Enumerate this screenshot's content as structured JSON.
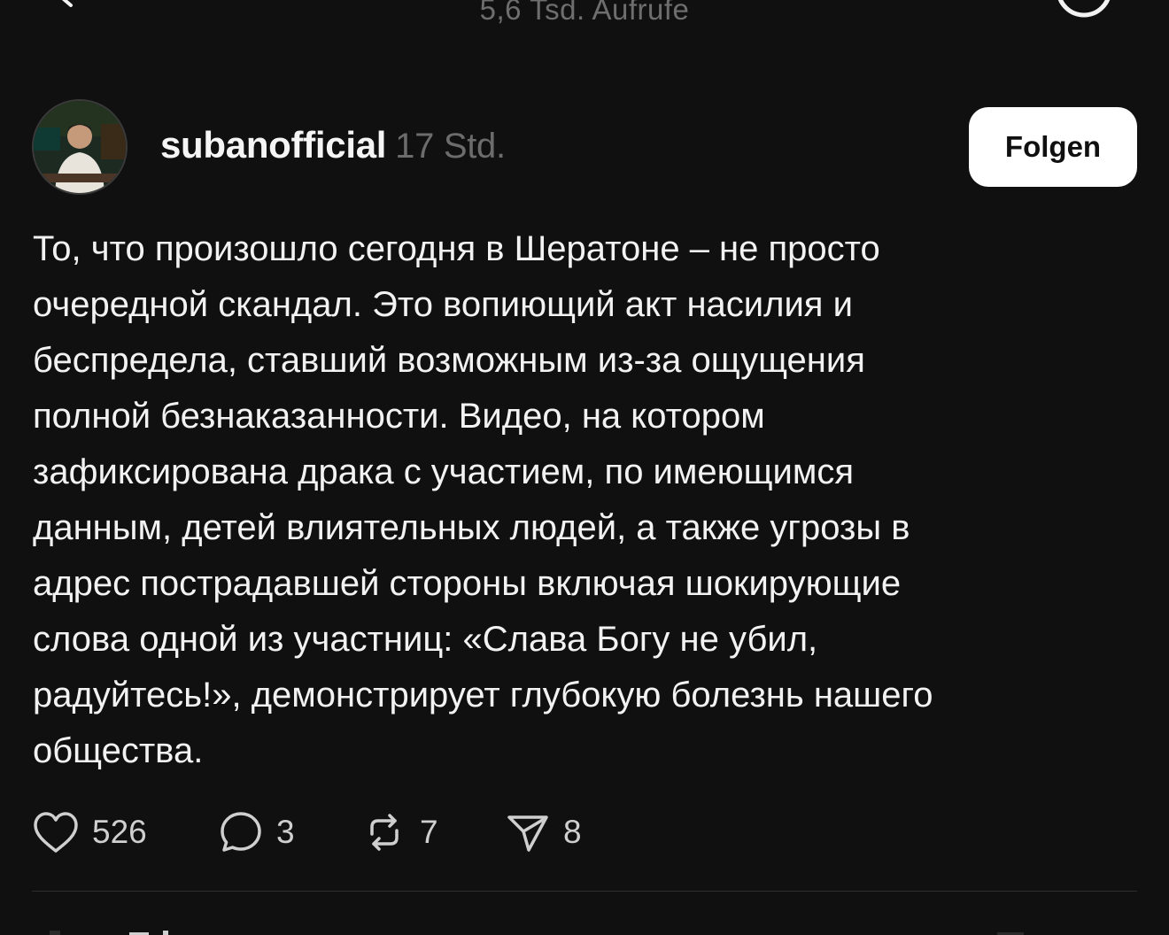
{
  "header": {
    "views_text": "5,6 Tsd. Aufrufe"
  },
  "post": {
    "username": "subanofficial",
    "time": "17 Std.",
    "follow_label": "Folgen",
    "text": "То, что произошло сегодня в Шератоне – не просто\nочередной скандал. Это вопиющий акт насилия и\nбеспредела, ставший возможным из-за ощущения\nполной безнаказанности. Видео, на котором\nзафиксирована драка с участием, по имеющимся\nданным, детей влиятельных людей, а также угрозы в\nадрес пострадавшей стороны включая шокирующие\nслова одной из участниц: «Слава Богу не убил,\nрадуйтесь!», демонстрирует глубокую болезнь нашего\nобщества.",
    "actions": {
      "likes": "526",
      "comments": "3",
      "reposts": "7",
      "shares": "8"
    }
  },
  "icons": {
    "like": "heart-icon",
    "comment": "comment-bubble-icon",
    "repost": "repost-icon",
    "share": "send-icon",
    "top_left": "back-icon",
    "top_right_1": "notification-icon",
    "top_right_2": "more-icon"
  },
  "colors": {
    "background": "#101010",
    "text": "#f2f2f2",
    "muted": "#6c6c6c",
    "button_bg": "#ffffff",
    "button_text": "#101010"
  }
}
